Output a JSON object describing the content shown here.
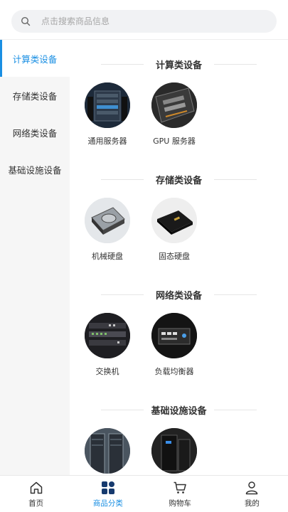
{
  "search": {
    "placeholder": "点击搜索商品信息",
    "icon": "search-icon"
  },
  "sidebar": {
    "items": [
      {
        "label": "计算类设备",
        "active": true
      },
      {
        "label": "存储类设备",
        "active": false
      },
      {
        "label": "网络类设备",
        "active": false
      },
      {
        "label": "基础设施设备",
        "active": false
      }
    ]
  },
  "sections": [
    {
      "title": "计算类设备",
      "products": [
        {
          "name": "通用服务器"
        },
        {
          "name": "GPU 服务器"
        }
      ]
    },
    {
      "title": "存储类设备",
      "products": [
        {
          "name": "机械硬盘"
        },
        {
          "name": "固态硬盘"
        }
      ]
    },
    {
      "title": "网络类设备",
      "products": [
        {
          "name": "交换机"
        },
        {
          "name": "负载均衡器"
        }
      ]
    },
    {
      "title": "基础设施设备",
      "products": [
        {
          "name": ""
        },
        {
          "name": ""
        }
      ]
    }
  ],
  "tabbar": {
    "tabs": [
      {
        "label": "首页",
        "icon": "home-icon"
      },
      {
        "label": "商品分类",
        "icon": "category-icon",
        "active": true
      },
      {
        "label": "购物车",
        "icon": "cart-icon"
      },
      {
        "label": "我的",
        "icon": "user-icon"
      }
    ]
  },
  "colors": {
    "accent": "#1a8fe3",
    "sidebar_bg": "#f6f6f6",
    "search_bg": "#f1f2f4"
  }
}
